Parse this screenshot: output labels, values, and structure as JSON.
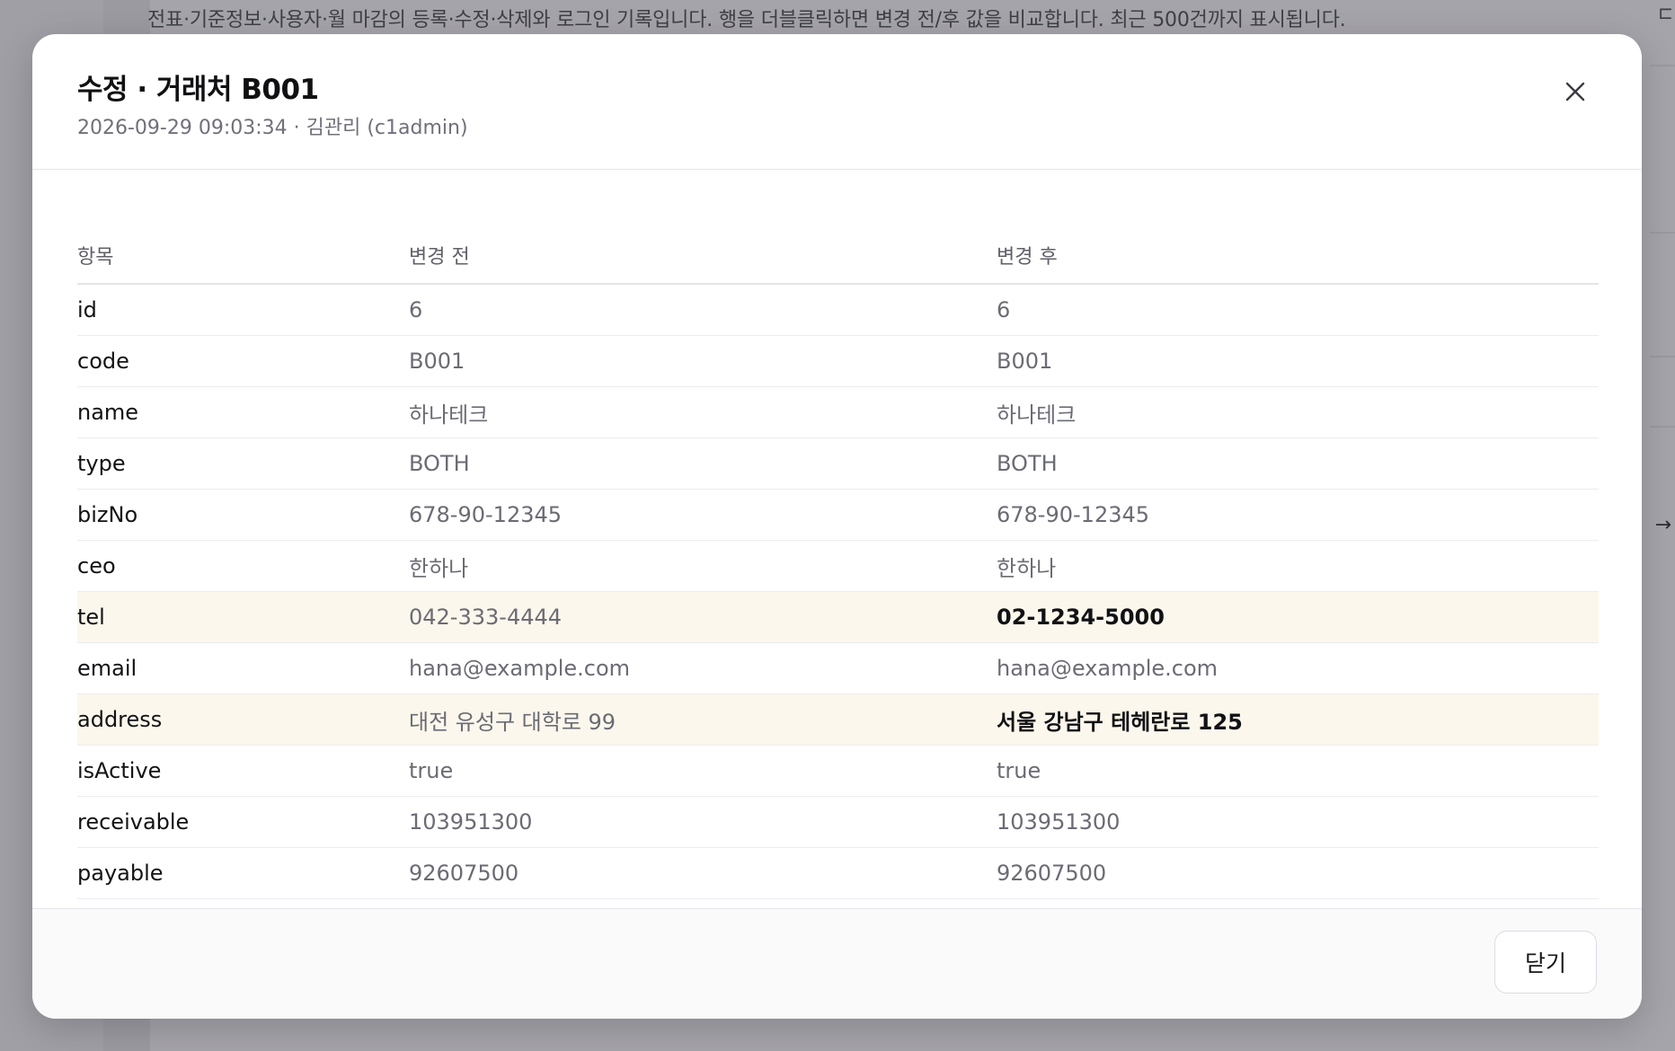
{
  "background": {
    "description": "전표·기준정보·사용자·월 마감의 등록·수정·삭제와 로그인 기록입니다. 행을 더블클릭하면 변경 전/후 값을 비교합니다. 최근 500건까지 표시됩니다."
  },
  "modal": {
    "title": "수정 · 거래처 B001",
    "subtitle": "2026-09-29 09:03:34 · 김관리 (c1admin)",
    "close_icon": "close-icon",
    "table": {
      "headers": [
        "항목",
        "변경 전",
        "변경 후"
      ],
      "rows": [
        {
          "field": "id",
          "before": "6",
          "after": "6",
          "changed": false
        },
        {
          "field": "code",
          "before": "B001",
          "after": "B001",
          "changed": false
        },
        {
          "field": "name",
          "before": "하나테크",
          "after": "하나테크",
          "changed": false
        },
        {
          "field": "type",
          "before": "BOTH",
          "after": "BOTH",
          "changed": false
        },
        {
          "field": "bizNo",
          "before": "678-90-12345",
          "after": "678-90-12345",
          "changed": false
        },
        {
          "field": "ceo",
          "before": "한하나",
          "after": "한하나",
          "changed": false
        },
        {
          "field": "tel",
          "before": "042-333-4444",
          "after": "02-1234-5000",
          "changed": true
        },
        {
          "field": "email",
          "before": "hana@example.com",
          "after": "hana@example.com",
          "changed": false
        },
        {
          "field": "address",
          "before": "대전 유성구 대학로 99",
          "after": "서울 강남구 테헤란로 125",
          "changed": true
        },
        {
          "field": "isActive",
          "before": "true",
          "after": "true",
          "changed": false
        },
        {
          "field": "receivable",
          "before": "103951300",
          "after": "103951300",
          "changed": false
        },
        {
          "field": "payable",
          "before": "92607500",
          "after": "92607500",
          "changed": false
        }
      ]
    },
    "footer": {
      "close_label": "닫기"
    }
  },
  "colors": {
    "overlay": "#a6a5ab",
    "changed_row_bg": "#fbf7ec",
    "muted_text": "#6b6b74"
  }
}
